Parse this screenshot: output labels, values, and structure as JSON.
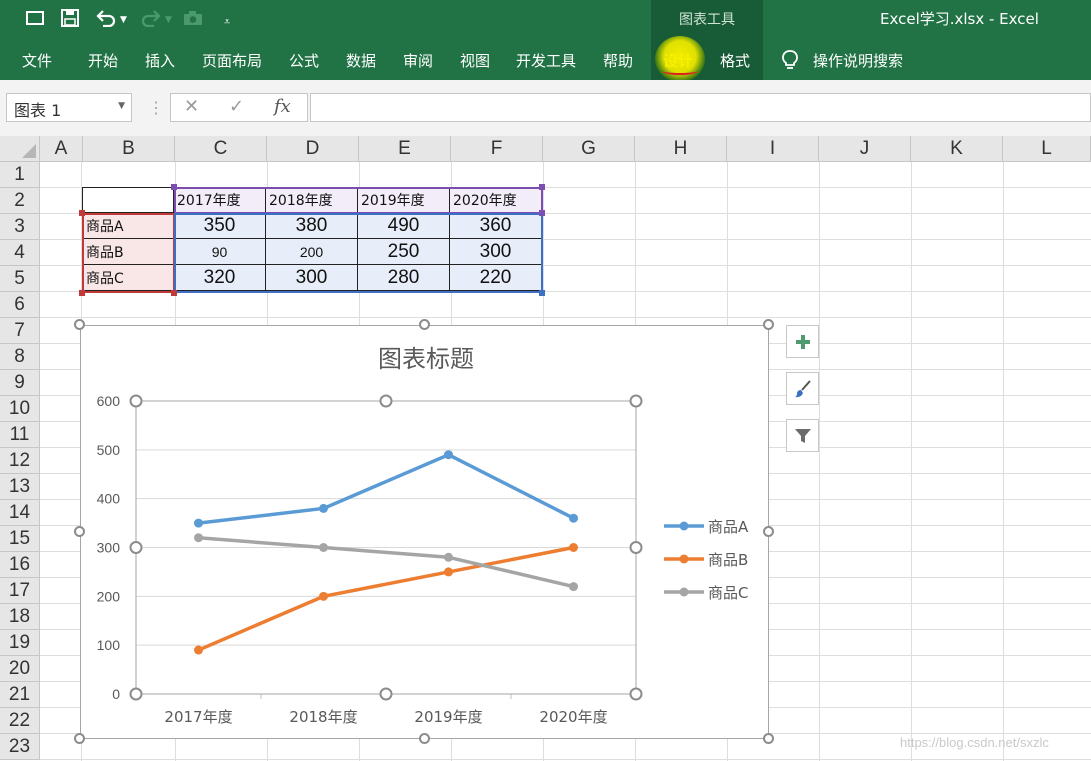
{
  "window": {
    "title": "Excel学习.xlsx  -  Excel",
    "context_group": "图表工具"
  },
  "quick_access": {
    "icons": [
      "window-icon",
      "save-icon",
      "undo-icon",
      "redo-icon",
      "camera-icon",
      "customize-icon"
    ]
  },
  "ribbon": {
    "tabs": [
      {
        "label": "文件"
      },
      {
        "label": "开始"
      },
      {
        "label": "插入"
      },
      {
        "label": "页面布局"
      },
      {
        "label": "公式"
      },
      {
        "label": "数据"
      },
      {
        "label": "审阅"
      },
      {
        "label": "视图"
      },
      {
        "label": "开发工具"
      },
      {
        "label": "帮助"
      },
      {
        "label": "设计",
        "active": true
      },
      {
        "label": "格式"
      }
    ],
    "tell_me": "操作说明搜索"
  },
  "formula_bar": {
    "name_box": "图表 1",
    "fx": "fx",
    "formula": ""
  },
  "sheet": {
    "columns": [
      "A",
      "B",
      "C",
      "D",
      "E",
      "F",
      "G",
      "H",
      "I",
      "J",
      "K",
      "L"
    ],
    "rows": [
      "1",
      "2",
      "3",
      "4",
      "5",
      "6",
      "7",
      "8",
      "9",
      "10",
      "11",
      "12",
      "13",
      "14",
      "15",
      "16",
      "17",
      "18",
      "19",
      "20",
      "21",
      "22",
      "23"
    ],
    "table": {
      "headers": [
        "2017年度",
        "2018年度",
        "2019年度",
        "2020年度"
      ],
      "rows": [
        {
          "label": "商品A",
          "values": [
            "350",
            "380",
            "490",
            "360"
          ]
        },
        {
          "label": "商品B",
          "values": [
            "90",
            "200",
            "250",
            "300"
          ]
        },
        {
          "label": "商品C",
          "values": [
            "320",
            "300",
            "280",
            "220"
          ]
        }
      ]
    }
  },
  "chart_data": {
    "type": "line",
    "title": "图表标题",
    "categories": [
      "2017年度",
      "2018年度",
      "2019年度",
      "2020年度"
    ],
    "series": [
      {
        "name": "商品A",
        "values": [
          350,
          380,
          490,
          360
        ],
        "color": "#5b9bd5"
      },
      {
        "name": "商品B",
        "values": [
          90,
          200,
          250,
          300
        ],
        "color": "#ed7d31"
      },
      {
        "name": "商品C",
        "values": [
          320,
          300,
          280,
          220
        ],
        "color": "#a5a5a5"
      }
    ],
    "yticks": [
      "0",
      "100",
      "200",
      "300",
      "400",
      "500",
      "600"
    ],
    "ylim": [
      0,
      600
    ],
    "grid": true,
    "legend": "right"
  },
  "chart_tools": {
    "buttons": [
      "chart-elements-icon",
      "chart-styles-icon",
      "chart-filters-icon"
    ]
  },
  "watermark": "https://blog.csdn.net/sxzlc"
}
